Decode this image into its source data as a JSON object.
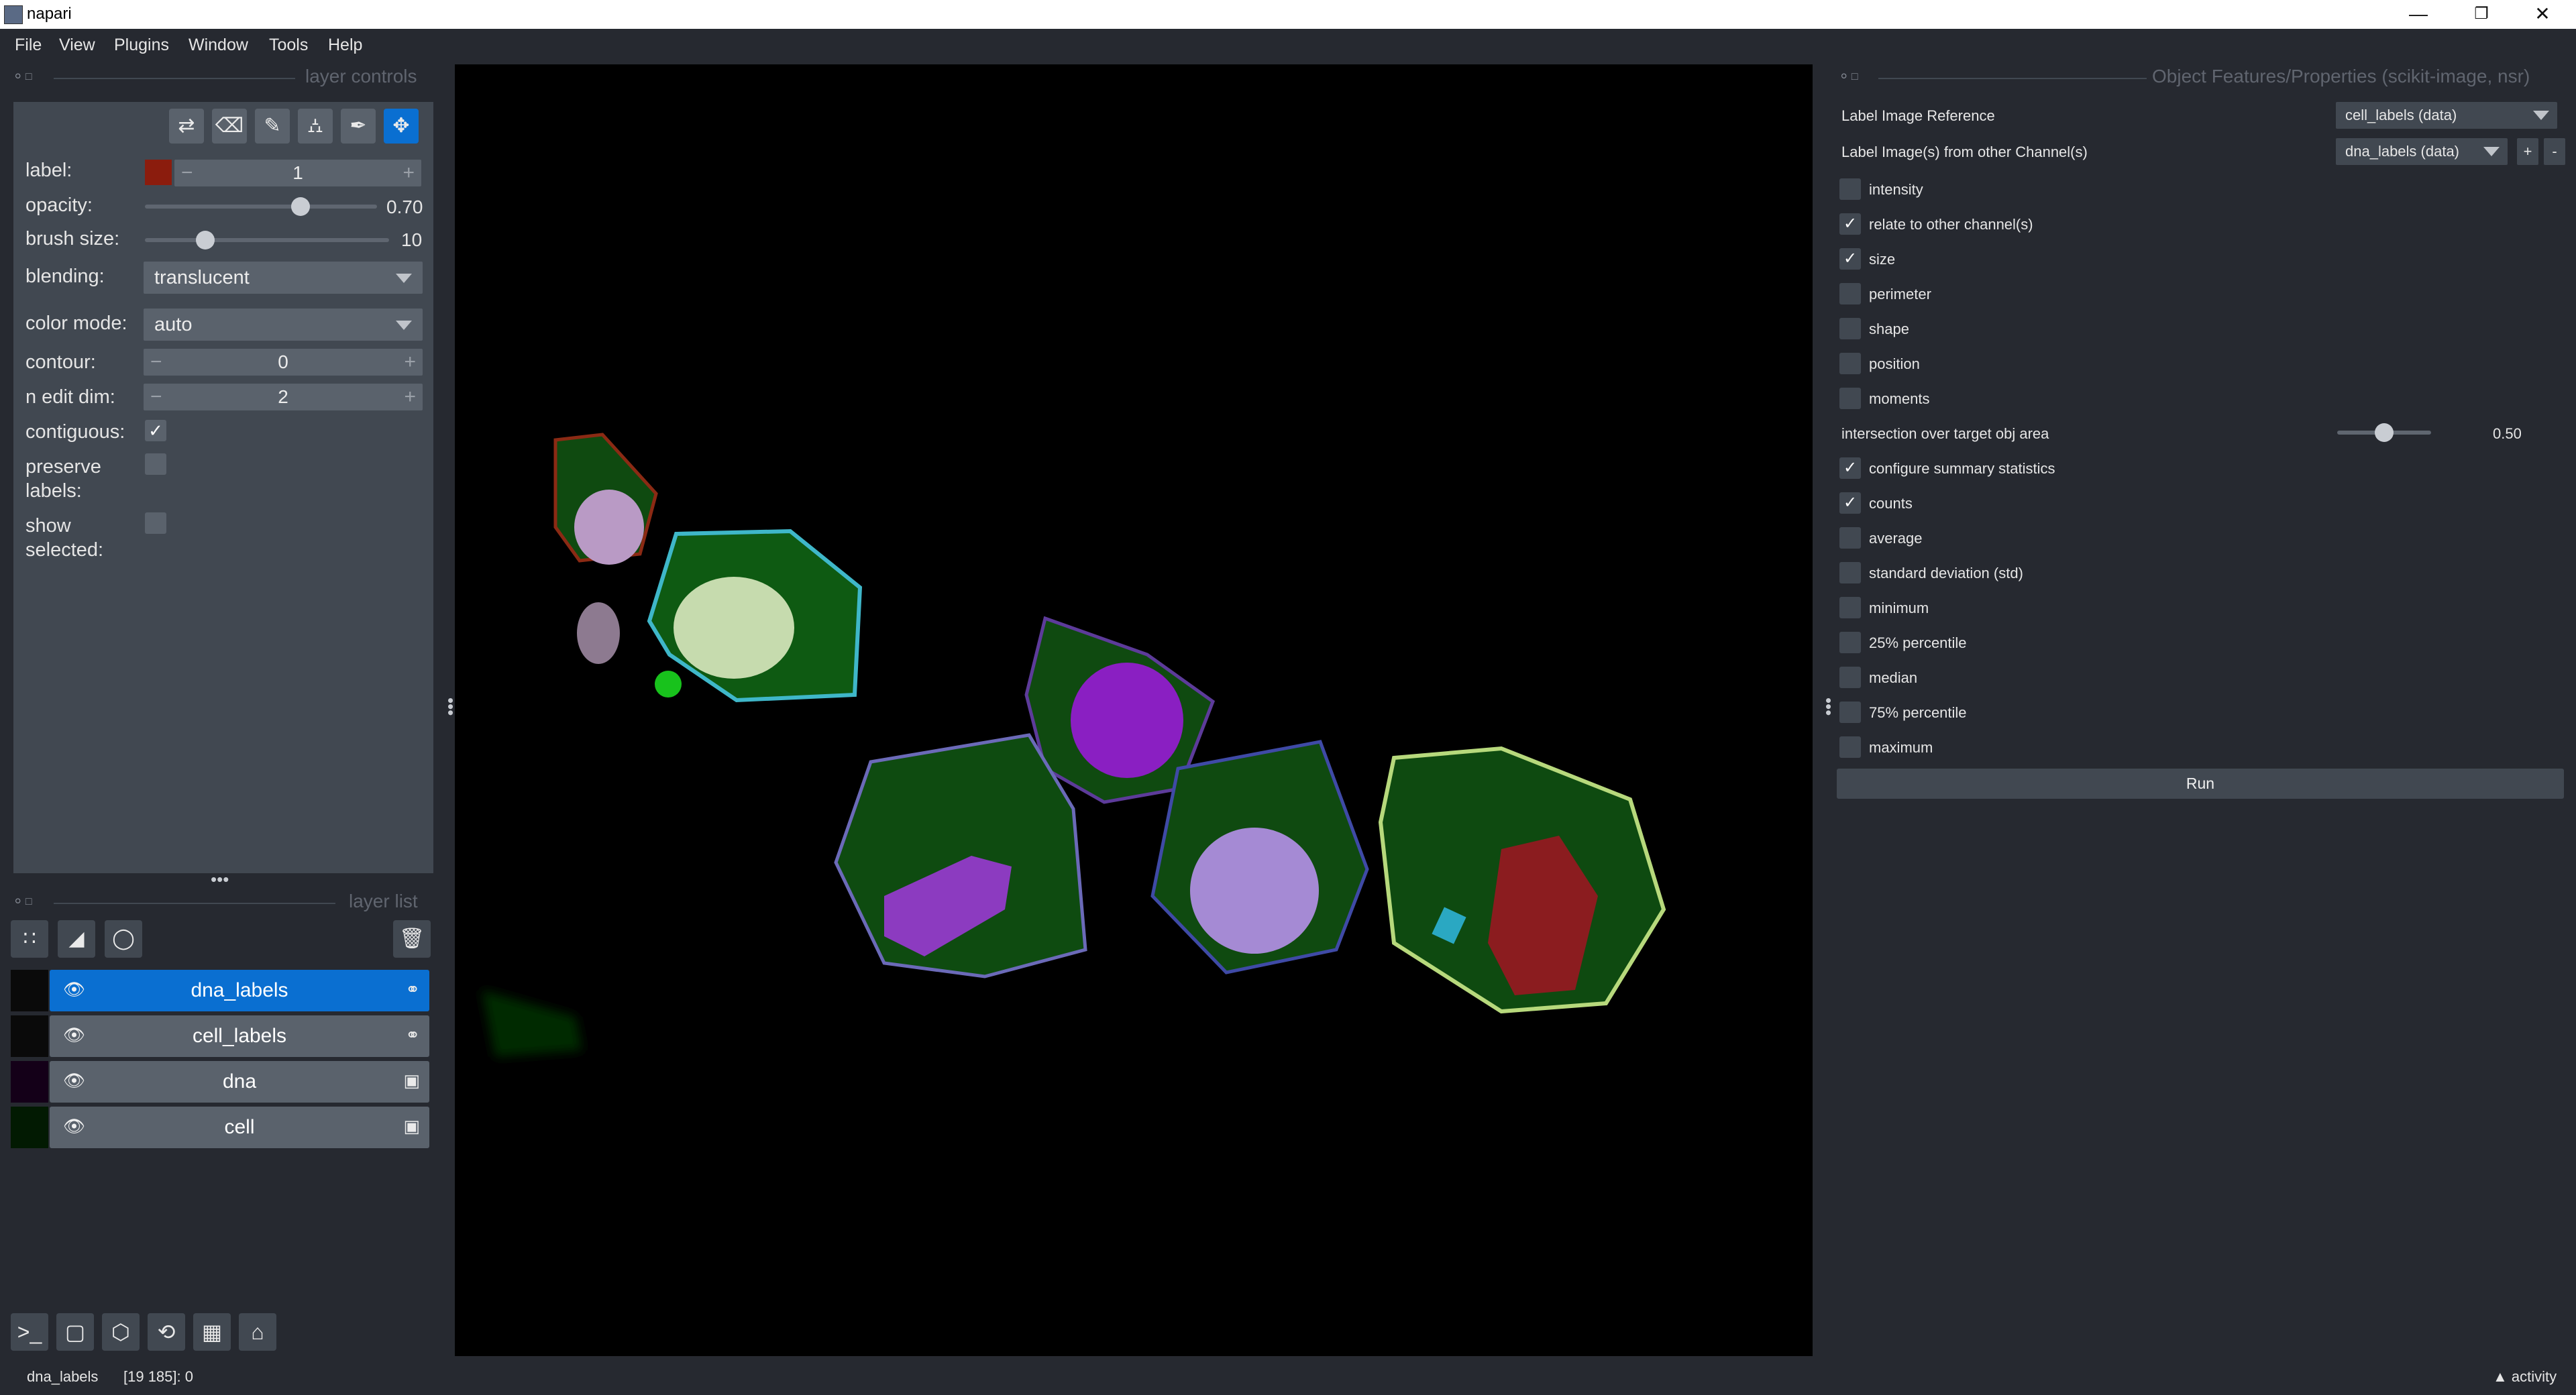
{
  "window": {
    "title": "napari",
    "minimize": "—",
    "restore": "❐",
    "close": "✕"
  },
  "menu": [
    "File",
    "View",
    "Plugins",
    "Window",
    "Tools",
    "Help"
  ],
  "layer_controls": {
    "title": "layer controls",
    "label": {
      "name": "label:",
      "value": "1",
      "color": "#8b1c0d"
    },
    "opacity": {
      "name": "opacity:",
      "value": "0.70",
      "fraction": 0.7
    },
    "brush_size": {
      "name": "brush size:",
      "value": "10",
      "fraction": 0.1
    },
    "blending": {
      "name": "blending:",
      "value": "translucent"
    },
    "color_mode": {
      "name": "color mode:",
      "value": "auto"
    },
    "contour": {
      "name": "contour:",
      "value": "0"
    },
    "n_edit_dim": {
      "name": "n edit dim:",
      "value": "2"
    },
    "contiguous": {
      "name": "contiguous:",
      "checked": true
    },
    "preserve_labels": {
      "name": "preserve labels:",
      "checked": false
    },
    "show_selected": {
      "name": "show selected:",
      "checked": false
    }
  },
  "layer_list": {
    "title": "layer list",
    "layers": [
      {
        "name": "dna_labels",
        "selected": true,
        "type_icon": "label-tag-icon"
      },
      {
        "name": "cell_labels",
        "selected": false,
        "type_icon": "label-tag-icon"
      },
      {
        "name": "dna",
        "selected": false,
        "type_icon": "image-icon"
      },
      {
        "name": "cell",
        "selected": false,
        "type_icon": "image-icon"
      }
    ]
  },
  "features_panel": {
    "title": "Object Features/Properties (scikit-image, nsr)",
    "label_image_reference": {
      "label": "Label Image Reference",
      "value": "cell_labels (data)"
    },
    "label_images_other": {
      "label": "Label Image(s) from other Channel(s)",
      "value": "dna_labels (data)",
      "add": "+",
      "remove": "-"
    },
    "options": [
      {
        "label": "intensity",
        "checked": false
      },
      {
        "label": "relate to other channel(s)",
        "checked": true
      },
      {
        "label": "size",
        "checked": true
      },
      {
        "label": "perimeter",
        "checked": false
      },
      {
        "label": "shape",
        "checked": false
      },
      {
        "label": "position",
        "checked": false
      },
      {
        "label": "moments",
        "checked": false
      }
    ],
    "intersection": {
      "label": "intersection over target obj area",
      "value": "0.50",
      "fraction": 0.5
    },
    "stats": [
      {
        "label": "configure summary statistics",
        "checked": true
      },
      {
        "label": "counts",
        "checked": true
      },
      {
        "label": "average",
        "checked": false
      },
      {
        "label": "standard deviation (std)",
        "checked": false
      },
      {
        "label": "minimum",
        "checked": false
      },
      {
        "label": "25% percentile",
        "checked": false
      },
      {
        "label": "median",
        "checked": false
      },
      {
        "label": "75% percentile",
        "checked": false
      },
      {
        "label": "maximum",
        "checked": false
      }
    ],
    "run": "Run"
  },
  "status": {
    "layer": "dna_labels",
    "coords": "[19 185]: 0",
    "activity": "activity"
  },
  "colors": {
    "accent": "#0a6fd1",
    "panel": "#414851",
    "background": "#262930"
  }
}
